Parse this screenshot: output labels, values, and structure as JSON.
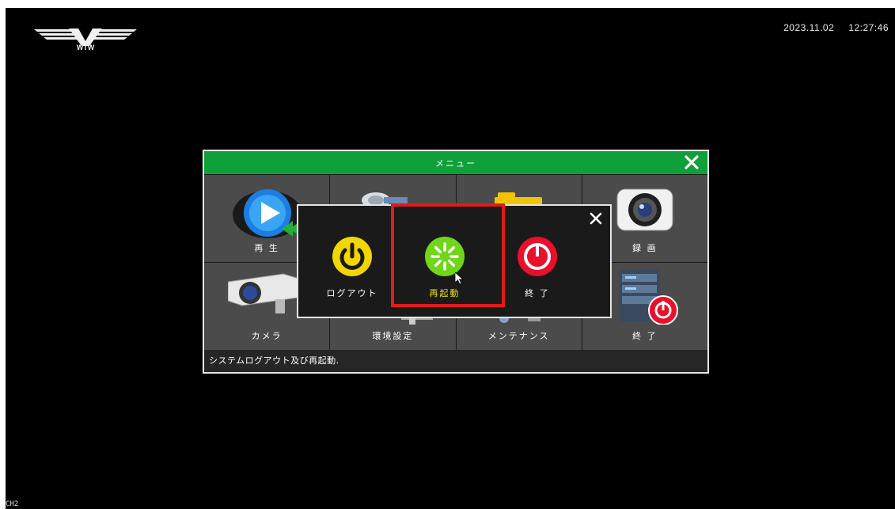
{
  "logo": {
    "text": "WTW"
  },
  "datetime": {
    "date": "2023.11.02",
    "time": "12:27:46"
  },
  "channel": "CH2",
  "menu": {
    "title": "メニュー",
    "tiles": [
      {
        "label": "再 生",
        "icon": "playback-icon"
      },
      {
        "label": "",
        "icon": "network-icon"
      },
      {
        "label": "",
        "icon": "folder-icon"
      },
      {
        "label": "録 画",
        "icon": "record-camera-icon"
      },
      {
        "label": "カメラ",
        "icon": "security-camera-icon"
      },
      {
        "label": "環境設定",
        "icon": "settings-icon"
      },
      {
        "label": "メンテナンス",
        "icon": "maintenance-icon"
      },
      {
        "label": "終 了",
        "icon": "server-shutdown-icon"
      }
    ],
    "status": "システムログアウト及び再起動."
  },
  "power_dialog": {
    "options": [
      {
        "label": "ログアウト",
        "icon": "logout-power-icon",
        "color": "#f2d600"
      },
      {
        "label": "再起動",
        "icon": "restart-icon",
        "color": "#6fd61a"
      },
      {
        "label": "終 了",
        "icon": "shutdown-icon",
        "color": "#e8102a"
      }
    ],
    "selected": "再起動"
  },
  "colors": {
    "title_bar": "#0fa03a",
    "highlight": "#e01b1b",
    "selected_text": "#f2e600"
  }
}
